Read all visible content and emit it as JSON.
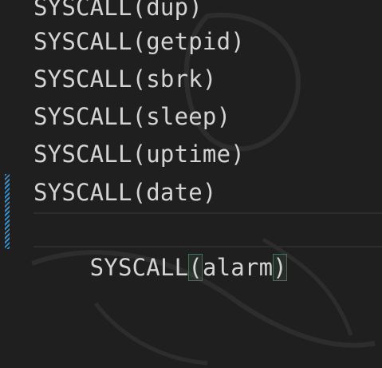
{
  "editor": {
    "lines": [
      {
        "text": "SYSCALL(dup)"
      },
      {
        "text": "SYSCALL(getpid)"
      },
      {
        "text": "SYSCALL(sbrk)"
      },
      {
        "text": "SYSCALL(sleep)"
      },
      {
        "text": "SYSCALL(uptime)"
      },
      {
        "text": "SYSCALL(date)"
      }
    ],
    "active_line": {
      "prefix": "SYSCALL",
      "open_paren": "(",
      "arg": "alarm",
      "close_paren": ")"
    }
  },
  "colors": {
    "background": "#1f1f1f",
    "text": "#d4d4d4",
    "gutter_modified": "#3b8fc6",
    "bracket_highlight": "#4a6b5a"
  }
}
